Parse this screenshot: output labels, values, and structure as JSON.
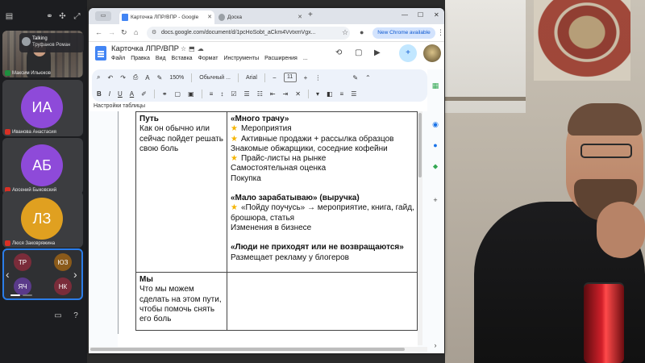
{
  "call": {
    "talking_label": "Talking",
    "talking_name": "Труфанов Роман",
    "participants": [
      {
        "name": "Максим Ильюков",
        "initials": "",
        "color": ""
      },
      {
        "name": "Иванова Анастасия",
        "initials": "ИА",
        "color": "#8e4ad9"
      },
      {
        "name": "Арсений Быковский",
        "initials": "АБ",
        "color": "#8e4ad9"
      },
      {
        "name": "Люся Заковряжина",
        "initials": "ЛЗ",
        "color": "#e0a020"
      }
    ],
    "grid_tiles": [
      {
        "initials": "ТР",
        "color": "#7a2c3a"
      },
      {
        "initials": "ЮЗ",
        "color": "#8a5a1a"
      },
      {
        "initials": "ЯЧ",
        "color": "#5a3a8a"
      },
      {
        "initials": "НК",
        "color": "#7a2c3a"
      }
    ]
  },
  "browser": {
    "tabs": [
      {
        "title": "Карточка ЛПР/ВПР - Google",
        "active": true
      },
      {
        "title": "Доска",
        "active": false
      }
    ],
    "url": "docs.google.com/document/d/1pcHoSobt_aCkm4VvtxmVgx...",
    "update_banner": "New Chrome available"
  },
  "docs": {
    "title": "Карточка ЛПР/ВПР",
    "menu": [
      "Файл",
      "Правка",
      "Вид",
      "Вставка",
      "Формат",
      "Инструменты",
      "Расширения",
      "..."
    ],
    "toolbar": {
      "zoom": "150%",
      "style": "Обычный ...",
      "font": "Arial",
      "font_size": "11",
      "table_settings": "Настройки таблицы"
    }
  },
  "table": {
    "row1": {
      "heading": "Путь",
      "desc": "Как он обычно или сейчас пойдет решать свою боль",
      "block1_title": "«Много трачу»",
      "block1_lines": [
        {
          "star": true,
          "text": "Мероприятия"
        },
        {
          "star": true,
          "text": "Активные продажи + рассылка образцов"
        },
        {
          "star": false,
          "text": "Знакомые обжарщики, соседние кофейни"
        },
        {
          "star": true,
          "text": "Прайс-листы на рынке"
        },
        {
          "star": false,
          "text": "Самостоятельная оценка"
        },
        {
          "star": false,
          "text": "Покупка"
        }
      ],
      "block2_title": "«Мало зарабатываю» (выручка)",
      "block2_lines": [
        {
          "star": true,
          "text": "«Пойду поучусь» → мероприятие, книга, гайд, брошюра, статья"
        },
        {
          "star": false,
          "text": "Изменения в бизнесе"
        }
      ],
      "block3_title": "«Люди не приходят или не возвращаются»",
      "block3_lines": [
        {
          "star": false,
          "text": "Размещает рекламу у блогеров"
        }
      ]
    },
    "row2": {
      "heading": "Мы",
      "desc": "Что мы можем сделать на этом пути, чтобы помочь снять его боль"
    }
  }
}
